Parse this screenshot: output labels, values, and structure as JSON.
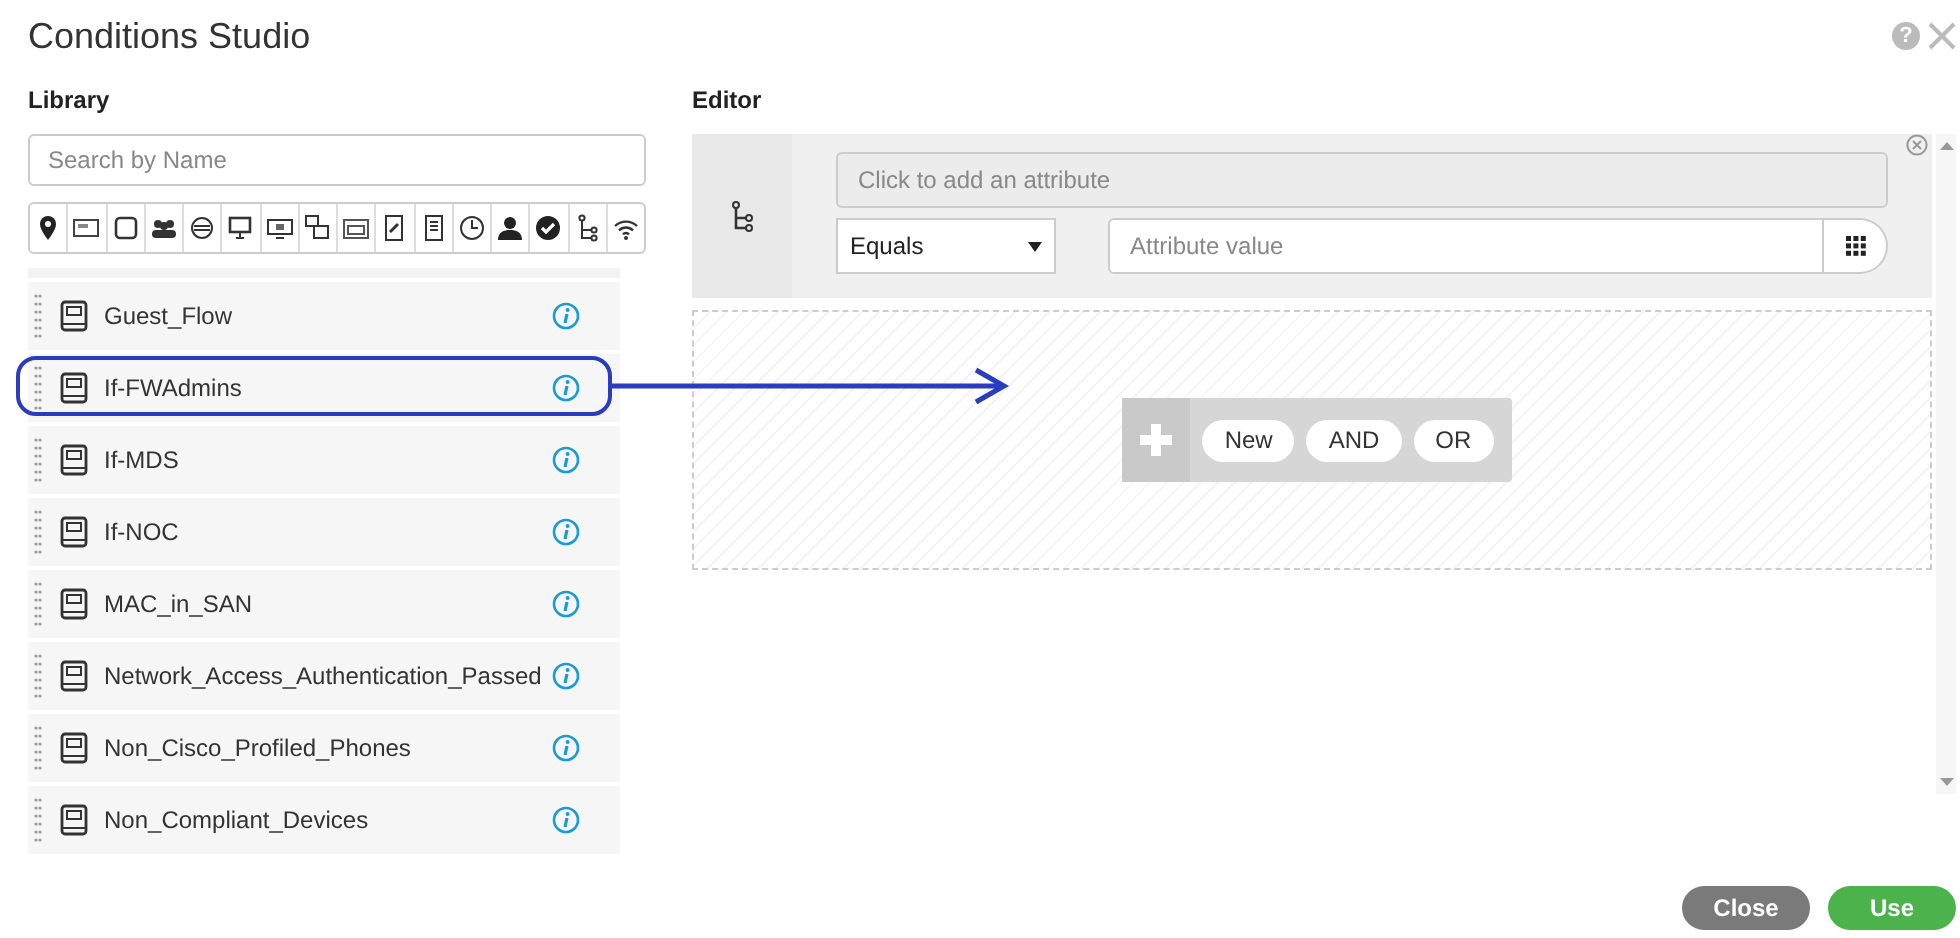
{
  "window": {
    "title": "Conditions Studio",
    "help": "?"
  },
  "library": {
    "heading": "Library",
    "search": {
      "placeholder": "Search by Name"
    },
    "items": [
      {
        "name": "Guest_Flow",
        "highlighted": false
      },
      {
        "name": "If-FWAdmins",
        "highlighted": true
      },
      {
        "name": "If-MDS",
        "highlighted": false
      },
      {
        "name": "If-NOC",
        "highlighted": false
      },
      {
        "name": "MAC_in_SAN",
        "highlighted": false
      },
      {
        "name": "Network_Access_Authentication_Passed",
        "highlighted": false
      },
      {
        "name": "Non_Cisco_Profiled_Phones",
        "highlighted": false
      },
      {
        "name": "Non_Compliant_Devices",
        "highlighted": false
      }
    ]
  },
  "editor": {
    "heading": "Editor",
    "attribute": {
      "placeholder": "Click to add an attribute"
    },
    "operator": "Equals",
    "value": {
      "placeholder": "Attribute value"
    },
    "actions": [
      "New",
      "AND",
      "OR"
    ]
  },
  "buttons": [
    {
      "label": "Close",
      "kind": "secondary"
    },
    {
      "label": "Use",
      "kind": "primary"
    }
  ]
}
